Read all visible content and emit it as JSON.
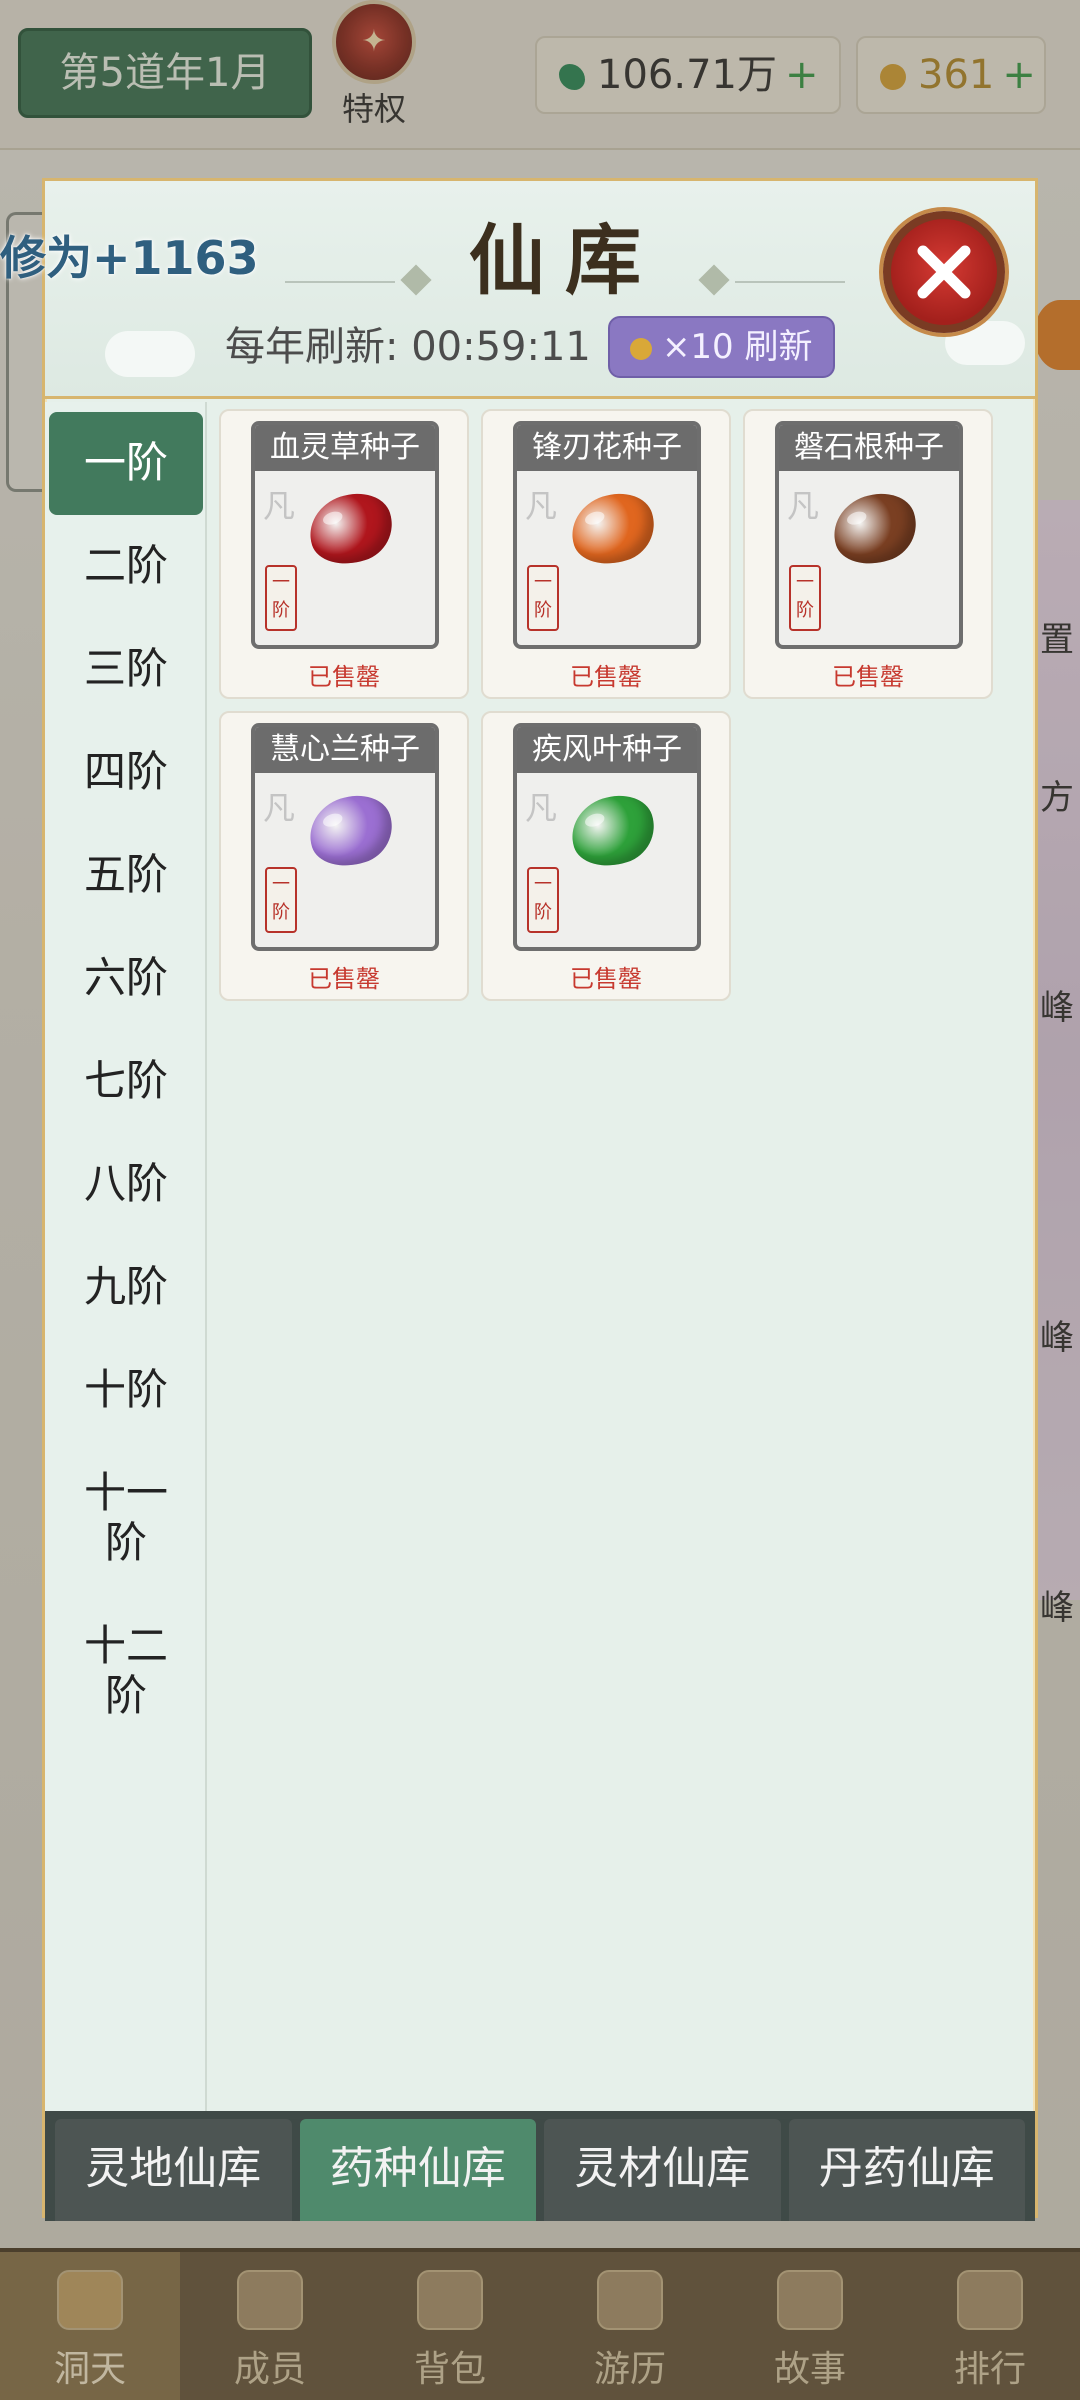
{
  "topbar": {
    "date": "第5道年1月",
    "perk_label": "特权",
    "jade_value": "106.71万",
    "gold_value": "361",
    "plus": "+"
  },
  "float_text": "修为+1163",
  "modal": {
    "title": "仙库",
    "refresh_label": "每年刷新: 00:59:11",
    "refresh_button": "×10 刷新"
  },
  "tiers": [
    "一阶",
    "二阶",
    "三阶",
    "四阶",
    "五阶",
    "六阶",
    "七阶",
    "八阶",
    "九阶",
    "十阶",
    "十一阶",
    "十二阶"
  ],
  "active_tier": "一阶",
  "items": [
    {
      "name": "血灵草种子",
      "grade": "凡",
      "tier_tag": "一阶",
      "status": "已售罄",
      "color": "#b0161d"
    },
    {
      "name": "锋刃花种子",
      "grade": "凡",
      "tier_tag": "一阶",
      "status": "已售罄",
      "color": "#e0661f"
    },
    {
      "name": "磐石根种子",
      "grade": "凡",
      "tier_tag": "一阶",
      "status": "已售罄",
      "color": "#7a3f22"
    },
    {
      "name": "慧心兰种子",
      "grade": "凡",
      "tier_tag": "一阶",
      "status": "已售罄",
      "color": "#9b6fd2"
    },
    {
      "name": "疾风叶种子",
      "grade": "凡",
      "tier_tag": "一阶",
      "status": "已售罄",
      "color": "#2ea13a"
    }
  ],
  "tabs": [
    "灵地仙库",
    "药种仙库",
    "灵材仙库",
    "丹药仙库"
  ],
  "active_tab": "药种仙库",
  "bottom_nav": [
    "洞天",
    "成员",
    "背包",
    "游历",
    "故事",
    "排行"
  ],
  "bottom_nav_active": "洞天",
  "peek": {
    "right_top": "置",
    "right_1": "方",
    "right_2": "峰",
    "right_3": "峰",
    "right_4": "峰"
  }
}
